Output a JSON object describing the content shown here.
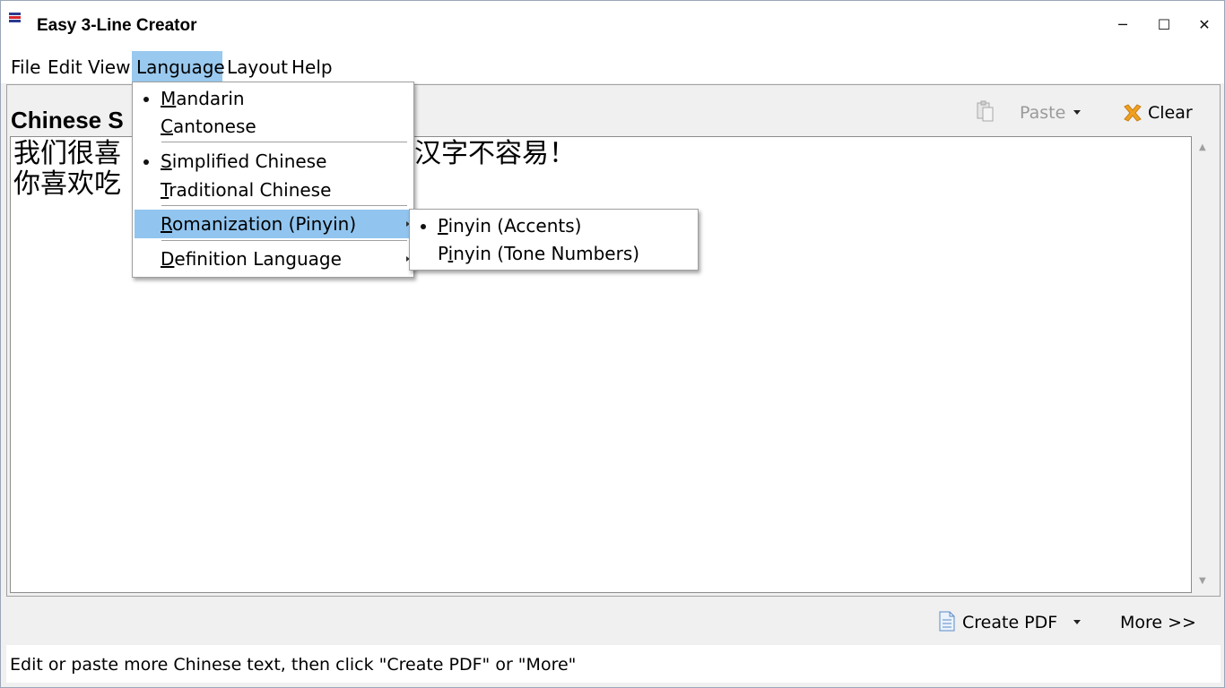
{
  "window": {
    "title": "Easy 3-Line Creator",
    "icon": "app-logo-icon",
    "controls": {
      "minimize": "─",
      "maximize": "☐",
      "close": "✕"
    }
  },
  "menubar": {
    "items": [
      {
        "label": "File"
      },
      {
        "label": "Edit"
      },
      {
        "label": "View"
      },
      {
        "label": "Language",
        "active": true
      },
      {
        "label": "Layout"
      },
      {
        "label": "Help"
      }
    ]
  },
  "language_menu": {
    "items": [
      {
        "first": "M",
        "rest": "andarin",
        "checked": true
      },
      {
        "first": "C",
        "rest": "antonese",
        "checked": false
      },
      {
        "first": "S",
        "rest": "implified Chinese",
        "checked": true
      },
      {
        "first": "T",
        "rest": "raditional Chinese",
        "checked": false
      },
      {
        "first": "R",
        "rest": "omanization (Pinyin)",
        "submenu": true,
        "highlighted": true
      },
      {
        "first": "D",
        "rest": "efinition Language",
        "submenu": true
      }
    ]
  },
  "romanization_submenu": {
    "items": [
      {
        "first": "P",
        "rest": "inyin (Accents)",
        "checked": true
      },
      {
        "first": "P",
        "rest": "inyin (Tone Numbers)",
        "checked": false,
        "underline_second": true
      }
    ]
  },
  "main": {
    "section_title": "Chinese S",
    "text_lines": [
      "我们很喜",
      "你喜欢吃"
    ],
    "text_line1_tail": "汉字不容易！",
    "toolbar": {
      "paste_label": "Paste",
      "clear_label": "Clear"
    }
  },
  "bottom": {
    "create_pdf_label": "Create PDF",
    "more_label": "More >>"
  },
  "status": {
    "text": "Edit or paste more Chinese text, then click \"Create PDF\" or \"More\""
  },
  "colors": {
    "menu_highlight": "#91c5ef",
    "icon_red": "#d9262c",
    "icon_blue": "#2b3a8f",
    "clear_icon_orange": "#f0a020"
  }
}
